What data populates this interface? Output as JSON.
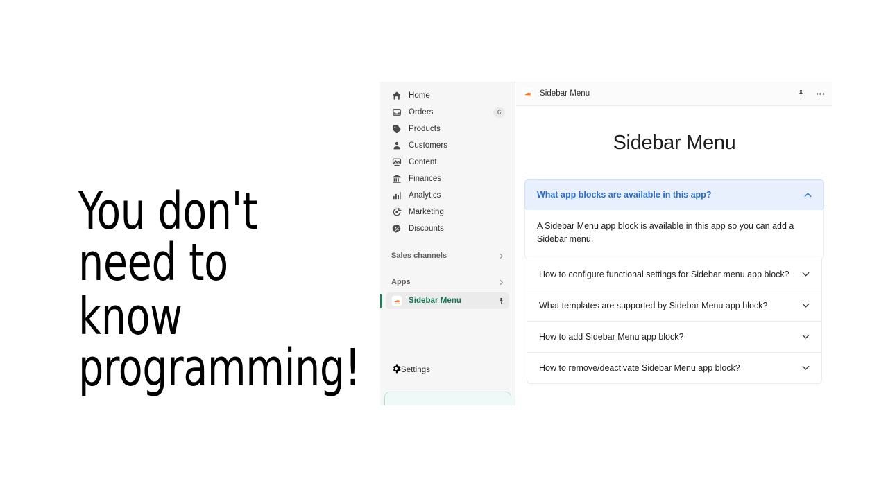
{
  "headline": {
    "line1": "You don't need to",
    "line2": "know programming!"
  },
  "sidebar": {
    "items": [
      {
        "label": "Home",
        "icon": "home-icon",
        "badge": ""
      },
      {
        "label": "Orders",
        "icon": "orders-icon",
        "badge": "6"
      },
      {
        "label": "Products",
        "icon": "products-icon",
        "badge": ""
      },
      {
        "label": "Customers",
        "icon": "customers-icon",
        "badge": ""
      },
      {
        "label": "Content",
        "icon": "content-icon",
        "badge": ""
      },
      {
        "label": "Finances",
        "icon": "finances-icon",
        "badge": ""
      },
      {
        "label": "Analytics",
        "icon": "analytics-icon",
        "badge": ""
      },
      {
        "label": "Marketing",
        "icon": "marketing-icon",
        "badge": ""
      },
      {
        "label": "Discounts",
        "icon": "discounts-icon",
        "badge": ""
      }
    ],
    "sections": [
      {
        "label": "Sales channels",
        "icon": "chevron-right-icon"
      },
      {
        "label": "Apps",
        "icon": "chevron-right-icon"
      }
    ],
    "active_app": {
      "label": "Sidebar Menu",
      "icon": "sidebar-menu-app-icon",
      "pin": "pin-icon"
    },
    "settings": {
      "label": "Settings",
      "icon": "gear-icon"
    },
    "accent_color": "#157750"
  },
  "topbar": {
    "title": "Sidebar Menu",
    "app_icon": "sidebar-menu-app-icon",
    "pin": "pin-icon",
    "more": "more-horizontal-icon"
  },
  "main": {
    "page_title": "Sidebar Menu",
    "faqs": [
      {
        "question": "What app blocks are available in this app?",
        "answer": "A Sidebar Menu app block is available in this app so you can add a Sidebar menu.",
        "open": true
      },
      {
        "question": "How to configure functional settings for Sidebar menu app block?",
        "answer": "",
        "open": false
      },
      {
        "question": "What templates are supported by Sidebar Menu app block?",
        "answer": "",
        "open": false
      },
      {
        "question": "How to add Sidebar Menu app block?",
        "answer": "",
        "open": false
      },
      {
        "question": "How to remove/deactivate Sidebar Menu app block?",
        "answer": "",
        "open": false
      }
    ],
    "highlight_color": "#2c6ecb",
    "highlight_bg": "#e8f0fd"
  }
}
